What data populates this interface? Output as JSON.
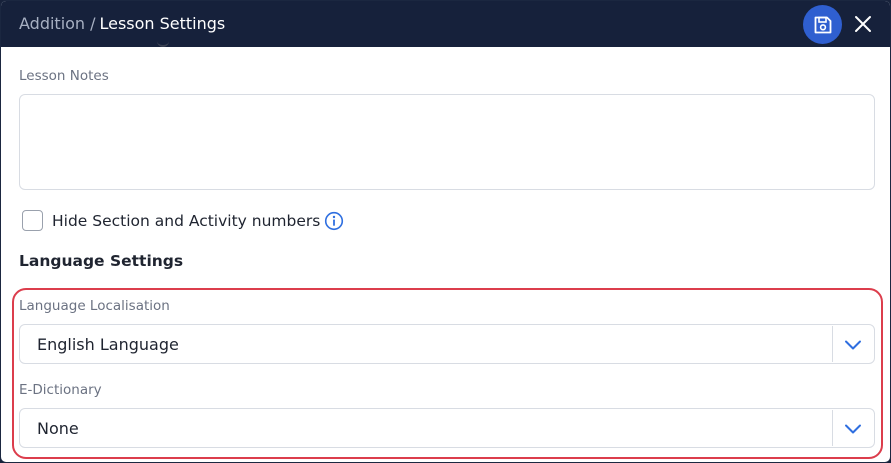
{
  "header": {
    "breadcrumb_parent": "Addition",
    "breadcrumb_separator": "/",
    "breadcrumb_current": "Lesson Settings",
    "save_icon": "floppy-disk-icon",
    "close_icon": "close-x-icon"
  },
  "lesson_notes": {
    "label": "Lesson Notes",
    "value": ""
  },
  "hide_numbers": {
    "label": "Hide Section and Activity numbers",
    "checked": false,
    "info_icon": "info-circle-icon"
  },
  "language_settings": {
    "title": "Language Settings",
    "localisation": {
      "label": "Language Localisation",
      "selected": "English Language"
    },
    "dictionary": {
      "label": "E-Dictionary",
      "selected": "None"
    }
  },
  "colors": {
    "header_bg": "#16213b",
    "save_button": "#2f5fd0",
    "accent_blue": "#2f5fd0",
    "highlight_red": "#dc3d4c"
  }
}
